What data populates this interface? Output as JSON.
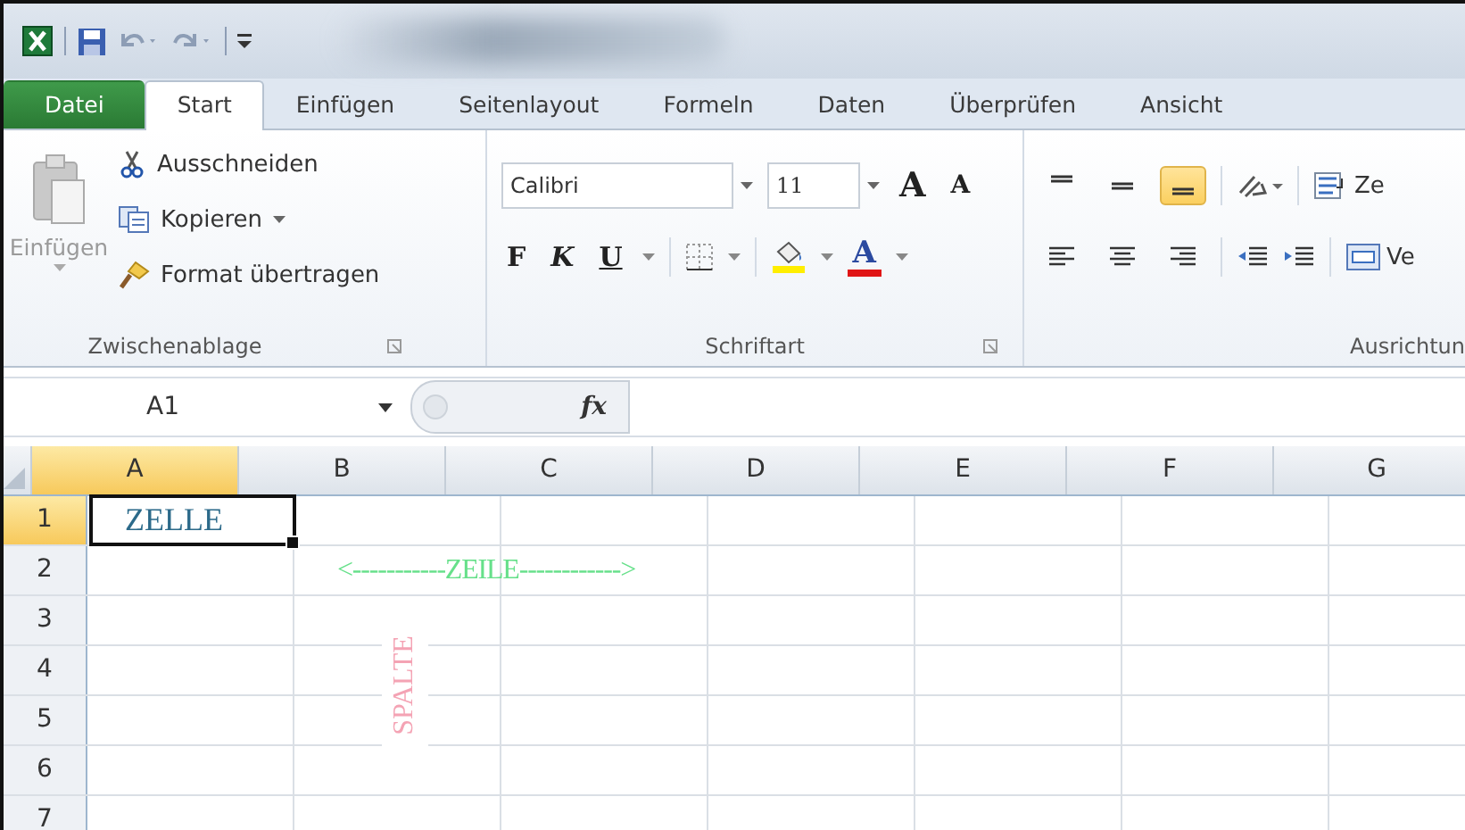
{
  "tabs": [
    {
      "label": "Datei",
      "kind": "file",
      "selected": false
    },
    {
      "label": "Start",
      "kind": "tab",
      "selected": true
    },
    {
      "label": "Einfügen",
      "kind": "tab",
      "selected": false
    },
    {
      "label": "Seitenlayout",
      "kind": "tab",
      "selected": false
    },
    {
      "label": "Formeln",
      "kind": "tab",
      "selected": false
    },
    {
      "label": "Daten",
      "kind": "tab",
      "selected": false
    },
    {
      "label": "Überprüfen",
      "kind": "tab",
      "selected": false
    },
    {
      "label": "Ansicht",
      "kind": "tab",
      "selected": false
    }
  ],
  "clipboard": {
    "title": "Zwischenablage",
    "paste": {
      "label": "Einfügen",
      "disabled": true
    },
    "items": [
      {
        "label": "Ausschneiden",
        "kind": "cut",
        "dropdown": false
      },
      {
        "label": "Kopieren",
        "kind": "copy",
        "dropdown": true
      },
      {
        "label": "Format übertragen",
        "kind": "painter",
        "dropdown": false
      }
    ]
  },
  "font": {
    "title": "Schriftart",
    "font_name": "Calibri",
    "font_size": "11",
    "grow": "A",
    "shrink": "A",
    "styles": [
      {
        "label": "F",
        "kind": "bold"
      },
      {
        "label": "K",
        "kind": "italic"
      },
      {
        "label": "U",
        "kind": "underline"
      }
    ],
    "font_color": "A"
  },
  "alignment": {
    "title": "Ausrichtun",
    "vertical": [
      {
        "kind": "top",
        "selected": false
      },
      {
        "kind": "middle",
        "selected": false
      },
      {
        "kind": "bottom",
        "selected": true
      }
    ],
    "horizontal": [
      {
        "kind": "left",
        "selected": false
      },
      {
        "kind": "center",
        "selected": false
      },
      {
        "kind": "right",
        "selected": false
      }
    ],
    "wrap": "Ze",
    "merge": "Ve"
  },
  "formula_bar": {
    "name_box": "A1",
    "function_label": "fx"
  },
  "grid": {
    "columns": [
      {
        "label": "A",
        "selected": true
      },
      {
        "label": "B",
        "selected": false
      },
      {
        "label": "C",
        "selected": false
      },
      {
        "label": "D",
        "selected": false
      },
      {
        "label": "E",
        "selected": false
      },
      {
        "label": "F",
        "selected": false
      },
      {
        "label": "G",
        "selected": false
      }
    ],
    "rows": [
      {
        "label": "1",
        "selected": true,
        "cells": [
          {
            "text": "ZELLE",
            "active": true
          }
        ]
      },
      {
        "label": "2",
        "selected": false
      },
      {
        "label": "3",
        "selected": false
      },
      {
        "label": "4",
        "selected": false
      },
      {
        "label": "5",
        "selected": false
      },
      {
        "label": "6",
        "selected": false
      },
      {
        "label": "7",
        "selected": false
      }
    ],
    "annotations": [
      {
        "kind": "horizontal",
        "text": "<-----------ZEILE------------>",
        "color": "#66e08a"
      },
      {
        "kind": "vertical",
        "text": "SPALTE",
        "color": "#f4a3b4"
      }
    ]
  }
}
